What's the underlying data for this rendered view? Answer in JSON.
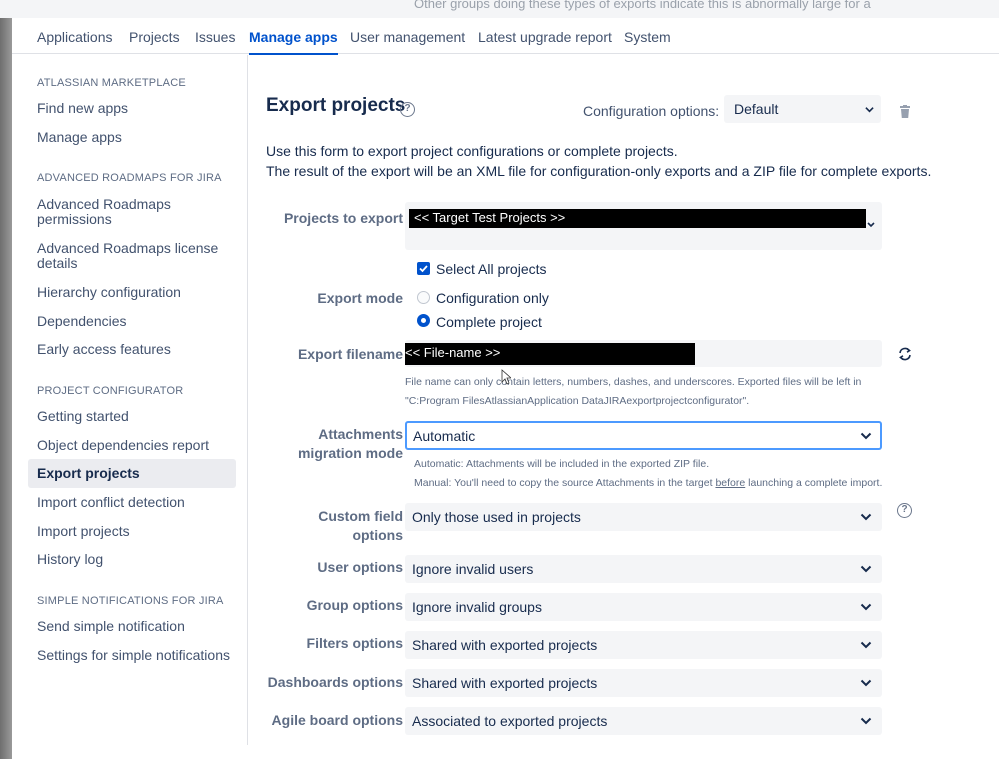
{
  "background_text": "Other groups doing these types of exports indicate this is abnormally large for a",
  "nav": {
    "tabs": [
      {
        "label": "Applications",
        "active": false
      },
      {
        "label": "Projects",
        "active": false
      },
      {
        "label": "Issues",
        "active": false
      },
      {
        "label": "Manage apps",
        "active": true
      },
      {
        "label": "User management",
        "active": false
      },
      {
        "label": "Latest upgrade report",
        "active": false
      },
      {
        "label": "System",
        "active": false
      }
    ]
  },
  "sidebar": {
    "sections": [
      {
        "heading": "ATLASSIAN MARKETPLACE",
        "items": [
          "Find new apps",
          "Manage apps"
        ]
      },
      {
        "heading": "ADVANCED ROADMAPS FOR JIRA",
        "items": [
          "Advanced Roadmaps permissions",
          "Advanced Roadmaps license details",
          "Hierarchy configuration",
          "Dependencies",
          "Early access features"
        ]
      },
      {
        "heading": "PROJECT CONFIGURATOR",
        "items": [
          "Getting started",
          "Object dependencies report",
          "Export projects",
          "Import conflict detection",
          "Import projects",
          "History log"
        ]
      },
      {
        "heading": "SIMPLE NOTIFICATIONS FOR JIRA",
        "items": [
          "Send simple notification",
          "Settings for simple notifications"
        ]
      }
    ],
    "active_item": "Export projects"
  },
  "page": {
    "title": "Export projects",
    "config_label": "Configuration options:",
    "config_value": "Default",
    "description_line1": "Use this form to export project configurations or complete projects.",
    "description_line2": "The result of the export will be an XML file for configuration-only exports and a ZIP file for complete exports."
  },
  "form": {
    "projects_label": "Projects to export",
    "projects_value": "<< Target Test Projects >>",
    "select_all_label": "Select All projects",
    "select_all_checked": true,
    "export_mode_label": "Export mode",
    "mode_config_label": "Configuration only",
    "mode_complete_label": "Complete project",
    "selected_mode": "Complete project",
    "filename_label": "Export filename",
    "filename_value": "<< File-name >>",
    "filename_help1": "File name can only contain letters, numbers, dashes, and underscores. Exported files will be left in",
    "filename_help2": "\"C:Program FilesAtlassianApplication DataJIRAexportprojectconfigurator\".",
    "attach_label_line1": "Attachments",
    "attach_label_line2": "migration mode",
    "attach_value": "Automatic",
    "attach_help1": "Automatic: Attachments will be included in the exported ZIP file.",
    "attach_help2_pre": "Manual: You'll need to copy the source Attachments in the target ",
    "attach_help2_link": "before",
    "attach_help2_post": " launching a complete import.",
    "custom_field_label_line1": "Custom field",
    "custom_field_label_line2": "options",
    "custom_field_value": "Only those used in projects",
    "user_label": "User options",
    "user_value": "Ignore invalid users",
    "group_label": "Group options",
    "group_value": "Ignore invalid groups",
    "filters_label": "Filters options",
    "filters_value": "Shared with exported projects",
    "dashboards_label": "Dashboards options",
    "dashboards_value": "Shared with exported projects",
    "agile_label": "Agile board options",
    "agile_value": "Associated to exported projects"
  },
  "icons": {
    "help": "question-circle-icon",
    "trash": "trash-icon",
    "refresh": "refresh-icon",
    "chevron": "chevron-down-icon"
  },
  "colors": {
    "accent": "#0052cc",
    "focus_border": "#4c9aff",
    "field_bg": "#f4f5f7",
    "active_sidebar_bg": "#ebecf0"
  }
}
